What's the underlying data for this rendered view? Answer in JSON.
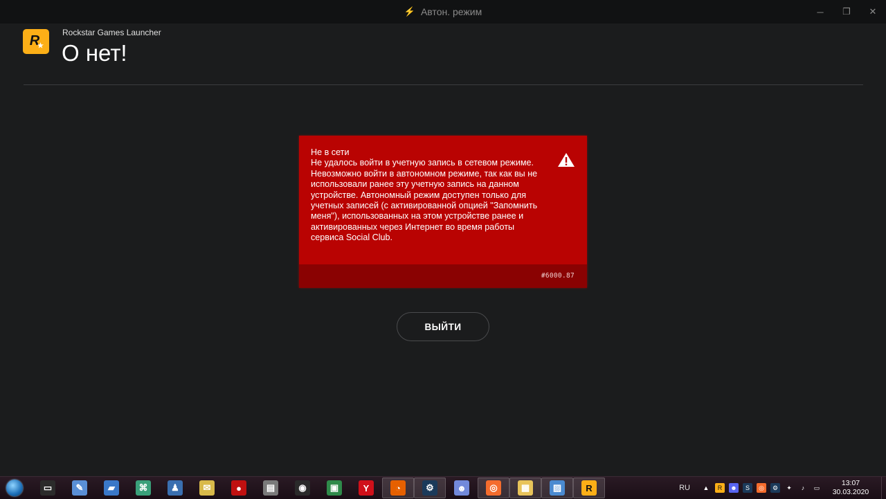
{
  "window": {
    "title": "Автон. режим",
    "controls": {
      "minimize": "─",
      "restore": "❐",
      "close": "✕"
    }
  },
  "header": {
    "app_name": "Rockstar Games Launcher",
    "page_title": "О нет!",
    "logo_letter": "R"
  },
  "error": {
    "lines": [
      "Не в сети",
      "Не удалось войти в учетную запись в сетевом режиме.",
      "Невозможно войти в автономном режиме, так как вы не",
      "использовали ранее эту учетную запись на данном",
      "устройстве. Автономный режим доступен только для",
      "учетных записей (с активированной опцией \"Запомнить",
      "меня\"), использованных на этом устройстве ранее и",
      "активированных через Интернет во время работы",
      "сервиса Social Club."
    ],
    "code": "#6000.87",
    "icon": "warning-icon",
    "color": "#b90302"
  },
  "actions": {
    "exit_label": "ВЫЙТИ"
  },
  "taskbar": {
    "apps": [
      {
        "name": "terminal-icon",
        "glyph": "▭",
        "color": "#2b2b2b"
      },
      {
        "name": "paint-icon",
        "glyph": "✎",
        "color": "#5a8fd6"
      },
      {
        "name": "drive-icon",
        "glyph": "▰",
        "color": "#3a78c8"
      },
      {
        "name": "network-icon",
        "glyph": "⌘",
        "color": "#3aa07a"
      },
      {
        "name": "users-icon",
        "glyph": "♟",
        "color": "#3a6fb0"
      },
      {
        "name": "folder-sync-icon",
        "glyph": "✉",
        "color": "#d8b94a"
      },
      {
        "name": "record-icon",
        "glyph": "●",
        "color": "#c01010"
      },
      {
        "name": "archive-icon",
        "glyph": "▤",
        "color": "#7a7a7a"
      },
      {
        "name": "obs-icon",
        "glyph": "◉",
        "color": "#2a2a2a"
      },
      {
        "name": "monitor-icon",
        "glyph": "▣",
        "color": "#2f8a4a"
      },
      {
        "name": "yandex-browser-icon",
        "glyph": "Y",
        "color": "#d0101a"
      },
      {
        "name": "firefox-icon",
        "glyph": "◔",
        "color": "#e66000"
      },
      {
        "name": "steam-icon",
        "glyph": "⚙",
        "color": "#1b3a5a"
      },
      {
        "name": "discord-icon",
        "glyph": "☻",
        "color": "#7289da"
      },
      {
        "name": "origin-icon",
        "glyph": "◎",
        "color": "#f56c2d"
      },
      {
        "name": "explorer-icon",
        "glyph": "▦",
        "color": "#e8c35a"
      },
      {
        "name": "image-viewer-icon",
        "glyph": "▨",
        "color": "#4a8ad0"
      },
      {
        "name": "rockstar-launcher-icon",
        "glyph": "R",
        "color": "#fcaf17"
      }
    ],
    "active_index": [
      11,
      12,
      14,
      15,
      16,
      17
    ],
    "tray": {
      "language": "RU",
      "icons": [
        {
          "name": "tray-expand-icon",
          "glyph": "▲",
          "color": "transparent"
        },
        {
          "name": "tray-rockstar-icon",
          "glyph": "R",
          "color": "#fcaf17"
        },
        {
          "name": "tray-discord-icon",
          "glyph": "☻",
          "color": "#5865f2"
        },
        {
          "name": "tray-steam-icon",
          "glyph": "S",
          "color": "#1b3a5a"
        },
        {
          "name": "tray-origin-icon",
          "glyph": "◎",
          "color": "#f56c2d"
        },
        {
          "name": "tray-steam2-icon",
          "glyph": "⚙",
          "color": "#1b3a5a"
        },
        {
          "name": "tray-network-icon",
          "glyph": "✦",
          "color": "transparent"
        },
        {
          "name": "tray-volume-icon",
          "glyph": "♪",
          "color": "transparent"
        },
        {
          "name": "tray-action-center-icon",
          "glyph": "▭",
          "color": "transparent"
        }
      ],
      "time": "13:07",
      "date": "30.03.2020"
    }
  }
}
